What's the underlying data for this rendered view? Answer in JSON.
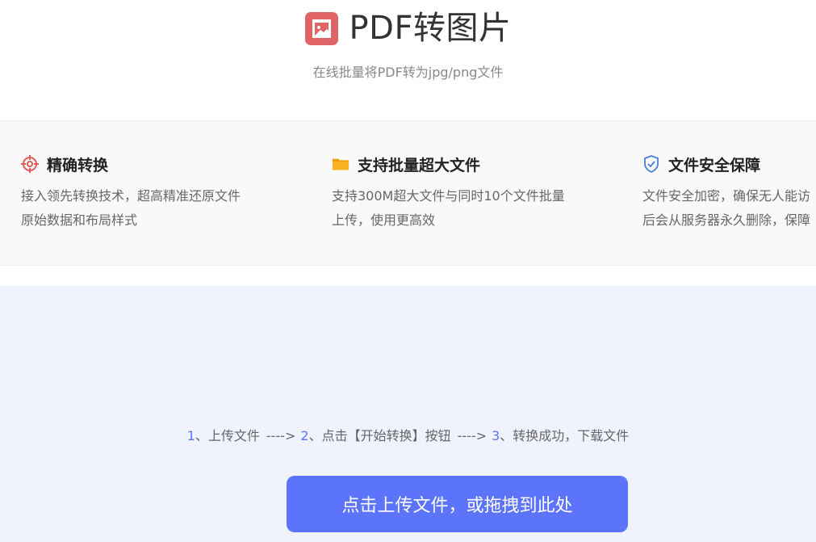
{
  "header": {
    "title": "PDF转图片",
    "subtitle": "在线批量将PDF转为jpg/png文件",
    "logo_color": "#e06466"
  },
  "features": [
    {
      "icon": "target-icon",
      "icon_color": "#e05a5a",
      "title": "精确转换",
      "desc_line1": "接入领先转换技术，超高精准还原文件",
      "desc_line2": "原始数据和布局样式"
    },
    {
      "icon": "folder-icon",
      "icon_color": "#f5a000",
      "title": "支持批量超大文件",
      "desc_line1": "支持300M超大文件与同时10个文件批量",
      "desc_line2": "上传，使用更高效"
    },
    {
      "icon": "shield-check-icon",
      "icon_color": "#4a7fd6",
      "title": "文件安全保障",
      "desc_line1": "文件安全加密，确保无人能访",
      "desc_line2": "后会从服务器永久删除，保障"
    }
  ],
  "steps": {
    "step1_num": "1",
    "step1_text": "、上传文件",
    "arrow1": "---->",
    "step2_num": "2",
    "step2_text": "、点击【开始转换】按钮",
    "arrow2": "---->",
    "step3_num": "3",
    "step3_text": "、转换成功，下载文件"
  },
  "upload": {
    "button_label": "点击上传文件，或拖拽到此处",
    "button_color": "#5b74fb"
  }
}
